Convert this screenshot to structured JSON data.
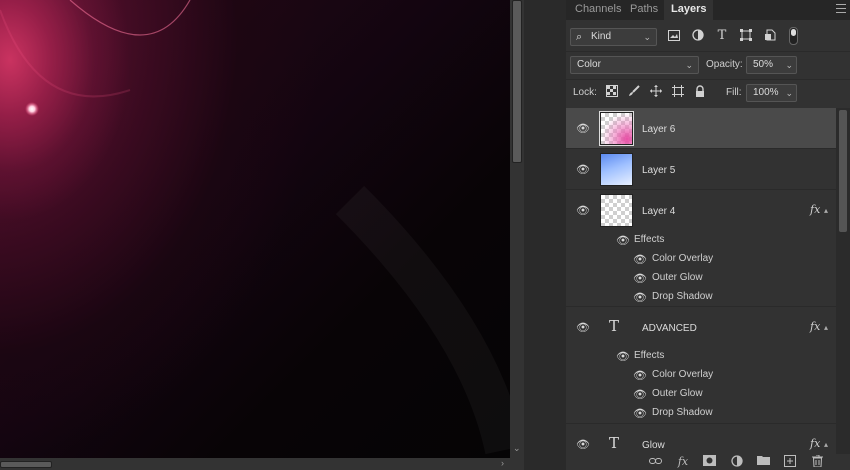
{
  "panel": {
    "tabs": [
      {
        "label": "Channels"
      },
      {
        "label": "Paths"
      },
      {
        "label": "Layers"
      }
    ],
    "filter": {
      "kind_label": "Kind",
      "icons": [
        "image-filter-icon",
        "adjustment-filter-icon",
        "type-filter-icon",
        "shape-filter-icon",
        "smart-object-filter-icon"
      ]
    },
    "blend": {
      "mode": "Color",
      "opacity_label": "Opacity:",
      "opacity_value": "50%"
    },
    "lock": {
      "label": "Lock:",
      "icons": [
        "lock-transparent-icon",
        "lock-image-icon",
        "lock-position-icon",
        "lock-artboard-icon",
        "lock-all-icon"
      ],
      "fill_label": "Fill:",
      "fill_value": "100%"
    },
    "layers": [
      {
        "name": "Layer 6",
        "thumbnail": "pink-gradient-checker",
        "selected": true
      },
      {
        "name": "Layer 5",
        "thumbnail": "blue-gradient"
      },
      {
        "name": "Layer 4",
        "thumbnail": "transparent-checker",
        "fx": "fx",
        "effects_label": "Effects",
        "effects": [
          "Color Overlay",
          "Outer Glow",
          "Drop Shadow"
        ]
      },
      {
        "name": "ADVANCED",
        "type_glyph": "T",
        "fx": "fx",
        "effects_label": "Effects",
        "effects": [
          "Color Overlay",
          "Outer Glow",
          "Drop Shadow"
        ]
      },
      {
        "name": "Glow",
        "type_glyph": "T",
        "fx": "fx"
      }
    ],
    "bottom_icons": [
      "link-layers-icon",
      "fx-icon",
      "mask-icon",
      "adjustment-layer-icon",
      "group-folder-icon",
      "new-layer-icon",
      "trash-icon"
    ],
    "bottom_fx": "fx"
  },
  "colors": {
    "canvas_accent": "#ce3462",
    "panel_bg": "#323232",
    "selected_row": "#4a4a4a"
  }
}
